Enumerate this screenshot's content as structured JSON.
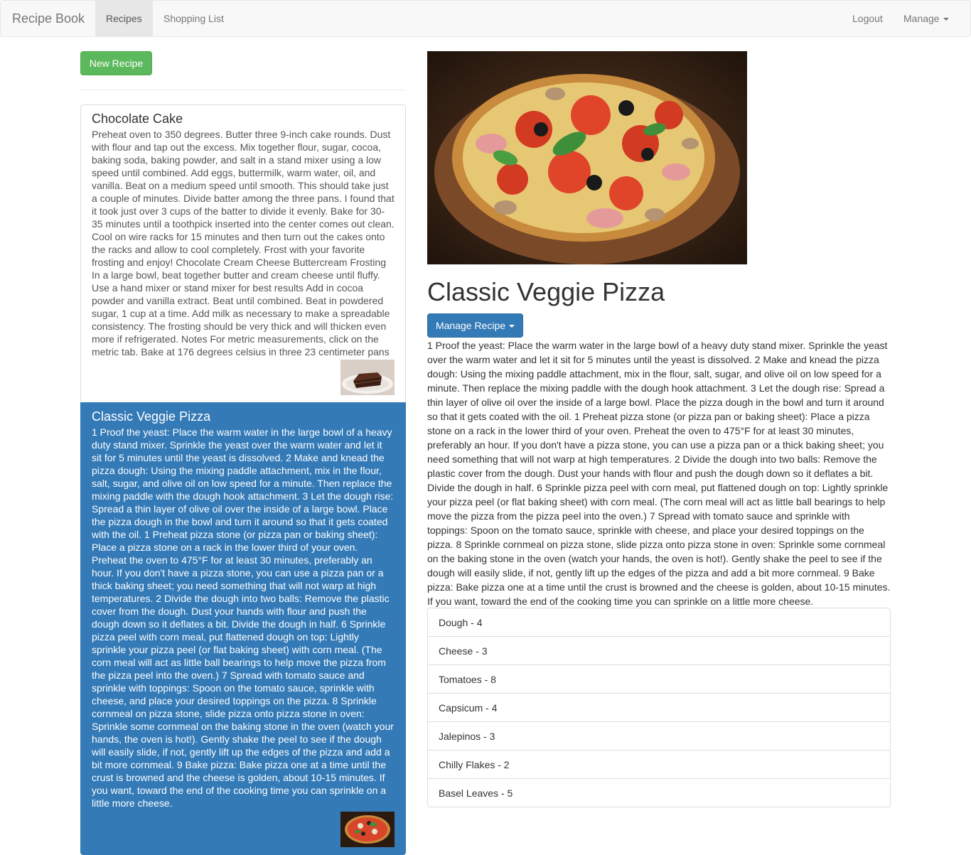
{
  "navbar": {
    "brand": "Recipe Book",
    "items": [
      "Recipes",
      "Shopping List"
    ],
    "right_items": [
      "Logout",
      "Manage"
    ]
  },
  "sidebar": {
    "new_recipe_label": "New Recipe",
    "recipes": [
      {
        "name": "Chocolate Cake",
        "description": "Preheat oven to 350 degrees. Butter three 9-inch cake rounds. Dust with flour and tap out the excess. Mix together flour, sugar, cocoa, baking soda, baking powder, and salt in a stand mixer using a low speed until combined. Add eggs, buttermilk, warm water, oil, and vanilla. Beat on a medium speed until smooth. This should take just a couple of minutes. Divide batter among the three pans. I found that it took just over 3 cups of the batter to divide it evenly. Bake for 30-35 minutes until a toothpick inserted into the center comes out clean. Cool on wire racks for 15 minutes and then turn out the cakes onto the racks and allow to cool completely. Frost with your favorite frosting and enjoy! Chocolate Cream Cheese Buttercream Frosting In a large bowl, beat together butter and cream cheese until fluffy. Use a hand mixer or stand mixer for best results Add in cocoa powder and vanilla extract. Beat until combined. Beat in powdered sugar, 1 cup at a time. Add milk as necessary to make a spreadable consistency. The frosting should be very thick and will thicken even more if refrigerated. Notes For metric measurements, click on the metric tab. Bake at 176 degrees celsius in three 23 centimeter pans",
        "active": false
      },
      {
        "name": "Classic Veggie Pizza",
        "description": "1 Proof the yeast: Place the warm water in the large bowl of a heavy duty stand mixer. Sprinkle the yeast over the warm water and let it sit for 5 minutes until the yeast is dissolved. 2 Make and knead the pizza dough: Using the mixing paddle attachment, mix in the flour, salt, sugar, and olive oil on low speed for a minute. Then replace the mixing paddle with the dough hook attachment. 3 Let the dough rise: Spread a thin layer of olive oil over the inside of a large bowl. Place the pizza dough in the bowl and turn it around so that it gets coated with the oil. 1 Preheat pizza stone (or pizza pan or baking sheet): Place a pizza stone on a rack in the lower third of your oven. Preheat the oven to 475°F for at least 30 minutes, preferably an hour. If you don't have a pizza stone, you can use a pizza pan or a thick baking sheet; you need something that will not warp at high temperatures. 2 Divide the dough into two balls: Remove the plastic cover from the dough. Dust your hands with flour and push the dough down so it deflates a bit. Divide the dough in half. 6 Sprinkle pizza peel with corn meal, put flattened dough on top: Lightly sprinkle your pizza peel (or flat baking sheet) with corn meal. (The corn meal will act as little ball bearings to help move the pizza from the pizza peel into the oven.) 7 Spread with tomato sauce and sprinkle with toppings: Spoon on the tomato sauce, sprinkle with cheese, and place your desired toppings on the pizza. 8 Sprinkle cornmeal on pizza stone, slide pizza onto pizza stone in oven: Sprinkle some cornmeal on the baking stone in the oven (watch your hands, the oven is hot!). Gently shake the peel to see if the dough will easily slide, if not, gently lift up the edges of the pizza and add a bit more cornmeal. 9 Bake pizza: Bake pizza one at a time until the crust is browned and the cheese is golden, about 10-15 minutes. If you want, toward the end of the cooking time you can sprinkle on a little more cheese.",
        "active": true
      }
    ]
  },
  "detail": {
    "title": "Classic Veggie Pizza",
    "manage_label": "Manage Recipe",
    "description": "1 Proof the yeast: Place the warm water in the large bowl of a heavy duty stand mixer. Sprinkle the yeast over the warm water and let it sit for 5 minutes until the yeast is dissolved. 2 Make and knead the pizza dough: Using the mixing paddle attachment, mix in the flour, salt, sugar, and olive oil on low speed for a minute. Then replace the mixing paddle with the dough hook attachment. 3 Let the dough rise: Spread a thin layer of olive oil over the inside of a large bowl. Place the pizza dough in the bowl and turn it around so that it gets coated with the oil. 1 Preheat pizza stone (or pizza pan or baking sheet): Place a pizza stone on a rack in the lower third of your oven. Preheat the oven to 475°F for at least 30 minutes, preferably an hour. If you don't have a pizza stone, you can use a pizza pan or a thick baking sheet; you need something that will not warp at high temperatures. 2 Divide the dough into two balls: Remove the plastic cover from the dough. Dust your hands with flour and push the dough down so it deflates a bit. Divide the dough in half. 6 Sprinkle pizza peel with corn meal, put flattened dough on top: Lightly sprinkle your pizza peel (or flat baking sheet) with corn meal. (The corn meal will act as little ball bearings to help move the pizza from the pizza peel into the oven.) 7 Spread with tomato sauce and sprinkle with toppings: Spoon on the tomato sauce, sprinkle with cheese, and place your desired toppings on the pizza. 8 Sprinkle cornmeal on pizza stone, slide pizza onto pizza stone in oven: Sprinkle some cornmeal on the baking stone in the oven (watch your hands, the oven is hot!). Gently shake the peel to see if the dough will easily slide, if not, gently lift up the edges of the pizza and add a bit more cornmeal. 9 Bake pizza: Bake pizza one at a time until the crust is browned and the cheese is golden, about 10-15 minutes. If you want, toward the end of the cooking time you can sprinkle on a little more cheese.",
    "ingredients": [
      "Dough - 4",
      "Cheese - 3",
      "Tomatoes - 8",
      "Capsicum - 4",
      "Jalepinos - 3",
      "Chilly Flakes - 2",
      "Basel Leaves - 5"
    ]
  },
  "colors": {
    "primary": "#337ab7",
    "success": "#5cb85c",
    "navbar_bg": "#f8f8f8"
  }
}
